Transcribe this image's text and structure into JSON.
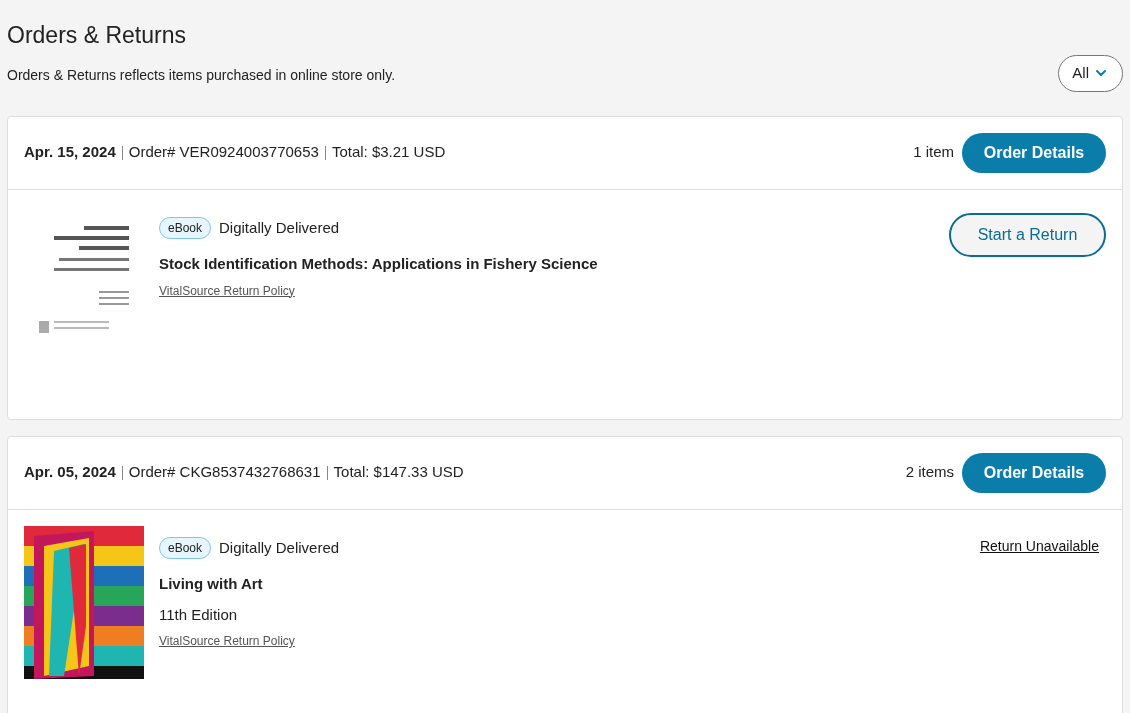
{
  "page": {
    "title": "Orders & Returns",
    "subtitle": "Orders & Returns reflects items purchased in online store only.",
    "filter": {
      "value": "All"
    }
  },
  "orders": [
    {
      "date": "Apr. 15, 2024",
      "order_no": "Order# VER0924003770653",
      "total": "Total: $3.21 USD",
      "count": "1 item",
      "details_button": "Order Details",
      "items": [
        {
          "format": "eBook",
          "delivery": "Digitally Delivered",
          "title": "Stock Identification Methods: Applications in Fishery Science",
          "policy": "VitalSource Return Policy",
          "return": {
            "kind": "button",
            "label": "Start a Return"
          }
        }
      ]
    },
    {
      "date": "Apr. 05, 2024",
      "order_no": "Order# CKG8537432768631",
      "total": "Total: $147.33 USD",
      "count": "2 items",
      "details_button": "Order Details",
      "items": [
        {
          "format": "eBook",
          "delivery": "Digitally Delivered",
          "title": "Living with Art",
          "edition": "11th Edition",
          "policy": "VitalSource Return Policy",
          "return": {
            "kind": "link",
            "label": "Return Unavailable"
          }
        }
      ]
    }
  ]
}
